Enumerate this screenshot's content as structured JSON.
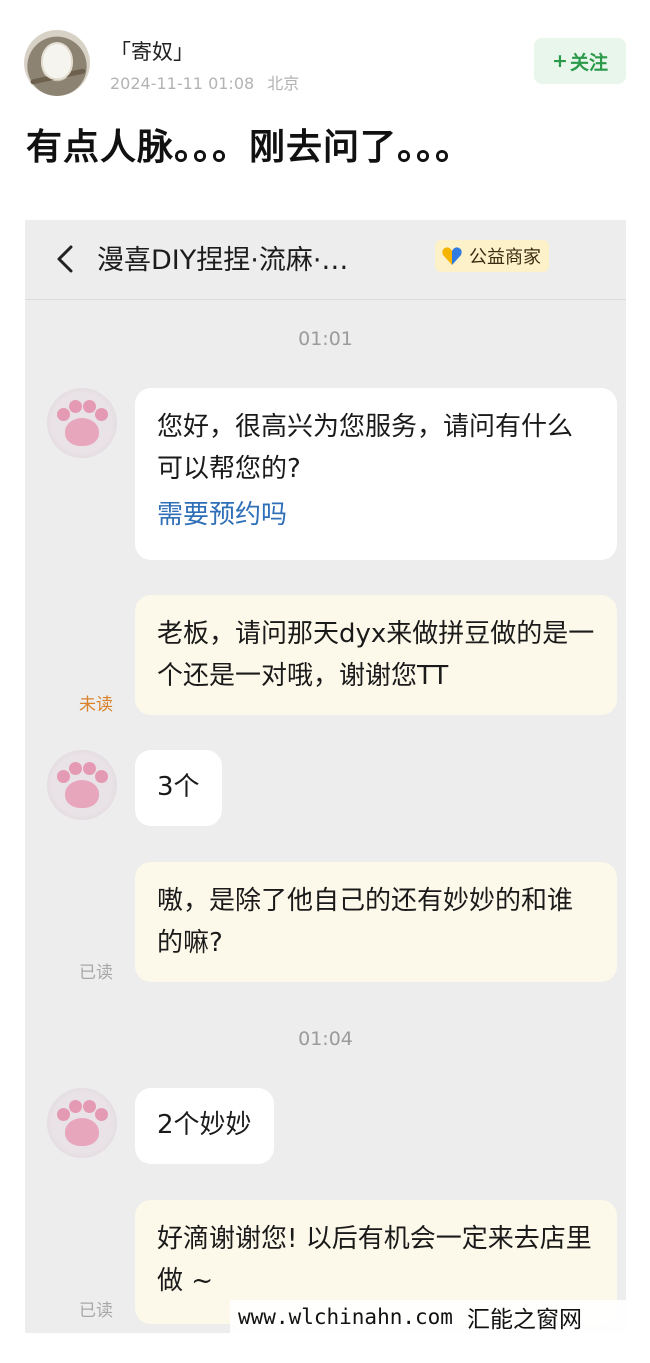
{
  "post": {
    "user_name": "「寄奴」",
    "date": "2024-11-11 01:08",
    "location": "北京",
    "follow_plus": "+",
    "follow_label": "关注",
    "title": "有点人脉。。。刚去问了。。。"
  },
  "chat": {
    "title": "漫喜DIY捏捏·流麻·…",
    "merchant_badge": "公益商家",
    "merchant_icon_colors": [
      "#f5b400",
      "#2f7be0"
    ],
    "messages": [
      {
        "type": "time",
        "text": "01:01"
      },
      {
        "type": "in",
        "text": "您好，很高兴为您服务，请问有什么可以帮您的?",
        "link": "需要预约吗"
      },
      {
        "type": "out",
        "text": "老板，请问那天dyx来做拼豆做的是一个还是一对哦，谢谢您TT",
        "status": "未读"
      },
      {
        "type": "in",
        "text": "3个"
      },
      {
        "type": "out",
        "text": "嗷，是除了他自己的还有妙妙的和谁的嘛?",
        "status": "已读"
      },
      {
        "type": "time",
        "text": "01:04"
      },
      {
        "type": "in",
        "text": "2个妙妙"
      },
      {
        "type": "out",
        "text": "好滴谢谢您! 以后有机会一定来去店里做 ~",
        "status": "已读"
      }
    ]
  },
  "watermark": {
    "url": "www.wlchinahn.com",
    "name": "汇能之窗网"
  }
}
